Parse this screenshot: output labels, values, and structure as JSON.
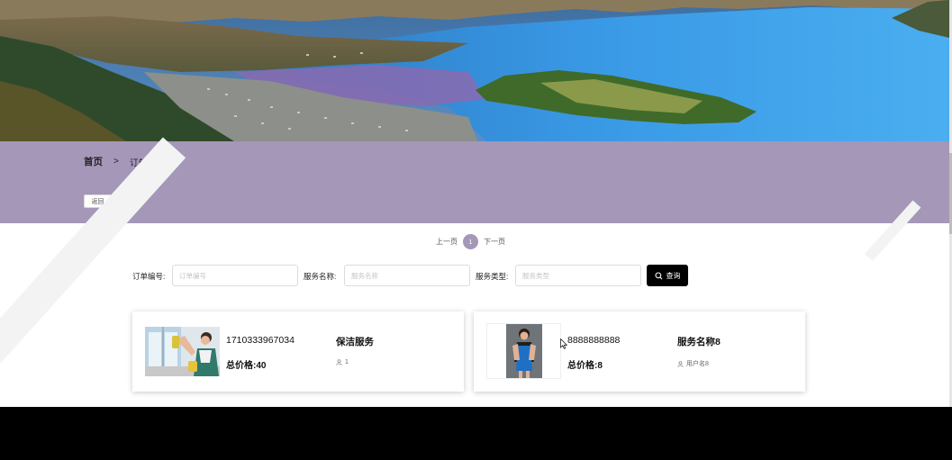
{
  "breadcrumb": {
    "home": "首页",
    "separator": ">",
    "current": "订单信息"
  },
  "back_button": "返回",
  "pagination": {
    "prev": "上一页",
    "current_page": "1",
    "next": "下一页"
  },
  "search": {
    "order_no_label": "订单编号:",
    "order_no_placeholder": "订单编号",
    "service_name_label": "服务名称:",
    "service_name_placeholder": "服务名称",
    "service_type_label": "服务类型:",
    "service_type_placeholder": "服务类型",
    "query_button": "查询",
    "query_icon": "search-icon"
  },
  "orders": [
    {
      "order_no": "1710333967034",
      "service_name": "保洁服务",
      "total_price": "总价格:40",
      "user": "1",
      "user_icon": "user-icon"
    },
    {
      "order_no": "8888888888",
      "service_name": "服务名称8",
      "total_price": "总价格:8",
      "user": "用户名8",
      "user_icon": "user-icon"
    }
  ],
  "colors": {
    "band": "#a497b8",
    "query_button": "#000000",
    "page_active": "#a497b8"
  }
}
